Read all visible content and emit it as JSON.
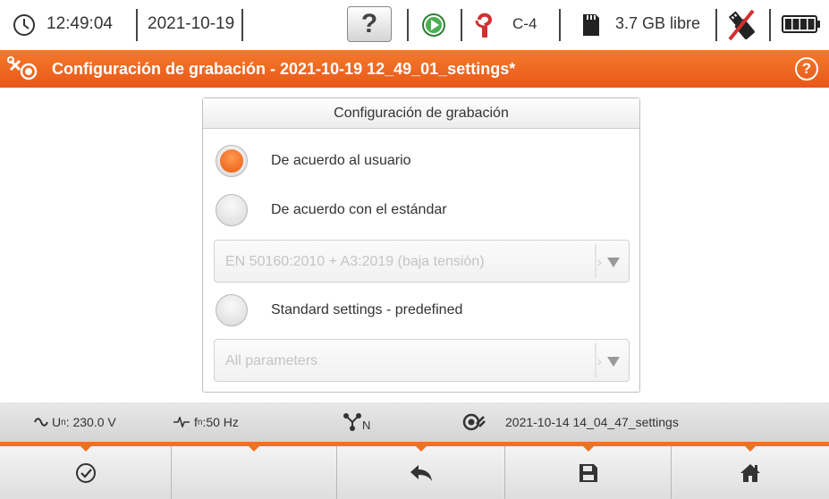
{
  "status_bar": {
    "time": "12:49:04",
    "date": "2021-10-19",
    "help_label": "?",
    "clamp_label": "C-4",
    "storage_free": "3.7 GB libre",
    "icons": [
      "clock-icon",
      "help-icon",
      "play-icon",
      "clamp-icon",
      "sd-card-icon",
      "usb-icon",
      "battery-icon"
    ]
  },
  "title_bar": {
    "title": "Configuración de grabación - 2021-10-19 12_49_01_settings*",
    "help_label": "?",
    "icon": "settings-tools-icon",
    "color": "#ee6620"
  },
  "panel": {
    "header": "Configuración de grabación",
    "options": [
      {
        "label": "De acuerdo al usuario",
        "selected": true
      },
      {
        "label": "De acuerdo con el estándar",
        "selected": false
      },
      {
        "label": "Standard settings - predefined",
        "selected": false
      }
    ],
    "standard_select": {
      "value": "EN 50160:2010 + A3:2019 (baja tensión)",
      "enabled": false
    },
    "parameters_select": {
      "value": "All parameters",
      "enabled": false
    }
  },
  "info_bar": {
    "voltage_prefix": "U",
    "voltage_sub": "n",
    "voltage_value": ": 230.0 V",
    "freq_prefix": "f",
    "freq_sub": "n",
    "freq_value": ":50 Hz",
    "network_sub": "N",
    "settings_file": "2021-10-14 14_04_47_settings",
    "icons": [
      "sine-wave-icon",
      "frequency-icon",
      "network-type-icon",
      "settings-file-icon"
    ]
  },
  "toolbar": {
    "buttons": [
      "confirm-icon",
      "empty",
      "back-icon",
      "save-icon",
      "home-icon"
    ]
  },
  "colors": {
    "accent": "#f37021",
    "radio_selected": "#ea5a10"
  }
}
